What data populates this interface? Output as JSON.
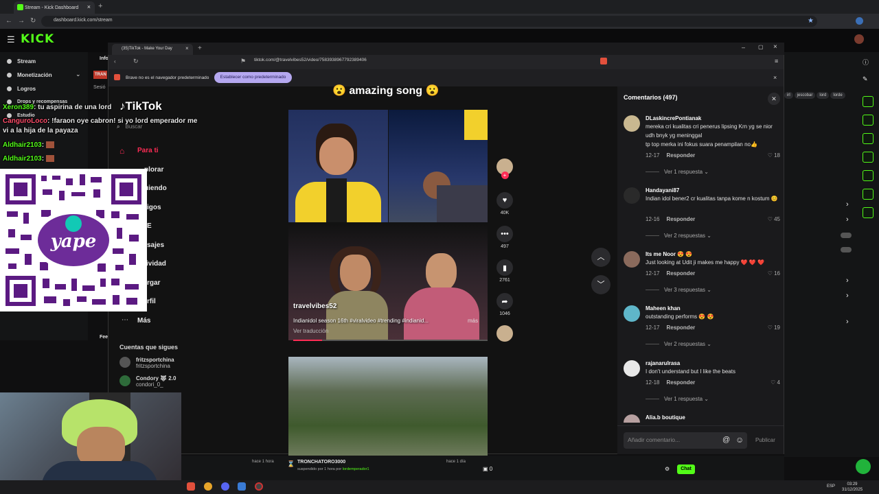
{
  "outer_browser": {
    "tab_title": "Stream - Kick Dashboard",
    "new_tab": "+",
    "url": "dashboard.kick.com/stream"
  },
  "kick": {
    "logo": "KICK",
    "sidebar": [
      {
        "label": "Stream",
        "icon": "broadcast-icon"
      },
      {
        "label": "Monetización",
        "icon": "money-icon"
      },
      {
        "label": "Logros",
        "icon": "trophy-icon"
      },
      {
        "label": "Drops y recompensas",
        "icon": "gift-icon"
      },
      {
        "label": "Estudio",
        "icon": "studio-icon"
      }
    ],
    "tags": [
      "irl",
      "jescobar",
      "lord",
      "lorde"
    ],
    "bottom_notice": {
      "name": "TRONCHATORO3000",
      "detail": "suspendido por 1 hora por ",
      "by": "lordemperador1",
      "time_left": "hace 1 hora",
      "time_right": "hace 1 día"
    },
    "viewer_count": "0",
    "chat_button": "Chat",
    "left_labels": {
      "info": "Info",
      "sesion": "Sesió",
      "fee": "Fee",
      "tran": "TRAN"
    }
  },
  "chat_overlay": [
    {
      "user": "Xeron389",
      "text": " tu aspirina de una lord"
    },
    {
      "user": "CanguroLoco",
      "text": " !faraon oye cabron! si yo lord emperador me"
    },
    {
      "user": "",
      "text": "vi a la hija de la payaza"
    },
    {
      "user": "Aldhair2103",
      "text": ""
    },
    {
      "user": "Aldhair2103",
      "text": ""
    }
  ],
  "tiktok_window": {
    "tab_title": "(35)TikTok - Make Your Day",
    "url": "tiktok.com/@travelvibes52/video/7583938967792389406",
    "infobar_message": "Brave no es el navegador predeterminado",
    "infobar_button": "Establecer como predeterminado"
  },
  "tiktok": {
    "logo": "TikTok",
    "search_placeholder": "Buscar",
    "nav": [
      {
        "label": "Para ti",
        "icon": "home-icon"
      },
      {
        "label": "plorar",
        "icon": "compass-icon"
      },
      {
        "label": "uiendo",
        "icon": "following-icon"
      },
      {
        "label": "igos",
        "icon": "friends-icon"
      },
      {
        "label": "E",
        "icon": "live-icon"
      },
      {
        "label": "sajes",
        "icon": "messages-icon"
      },
      {
        "label": "ividad",
        "icon": "activity-icon"
      },
      {
        "label": "rgar",
        "icon": "upload-icon"
      },
      {
        "label": "rfil",
        "icon": "profile-icon"
      },
      {
        "label": "Más",
        "icon": "more-icon"
      }
    ],
    "following_header": "Cuentas que sigues",
    "following": [
      {
        "name": "fritzsportchina",
        "handle": "fritzsportchina"
      },
      {
        "name": "Condory 🐺 2.0",
        "handle": "condori_0_"
      }
    ],
    "video": {
      "title": "amazing song",
      "author": "travelvibes52",
      "description": "Indianidol season 16th   #viralvideo #trending #indianid...",
      "more": "más",
      "translate": "Ver traducción",
      "progress": 0.15
    },
    "actions": {
      "likes": "40K",
      "comments": "497",
      "saves": "2761",
      "shares": "1046"
    },
    "comments_header": "Comentarios (497)",
    "comments": [
      {
        "user": "DLaskincrePontianak",
        "text": "mereka cri kualitas cri penerus lipsing Krn yg se nior udh bnyk yg meninggal\ntp top merka ini fokus suara penampilan no👍",
        "date": "12-17",
        "reply": "Responder",
        "likes": "18",
        "replies": "Ver 1 respuesta"
      },
      {
        "user": "Handayani87",
        "text": "Indian idol bener2 cr kualitas tanpa kome n kostum 😊",
        "date": "12-16",
        "reply": "Responder",
        "likes": "45",
        "replies": "Ver 2 respuestas"
      },
      {
        "user": "Its me Noor 😍 😍",
        "text": "Just looking at Udit ji makes me happy ❤️ ❤️ ❤️",
        "date": "12-17",
        "reply": "Responder",
        "likes": "16",
        "replies": "Ver 3 respuestas"
      },
      {
        "user": "Maheen khan",
        "text": "outstanding performs 😍 😍",
        "date": "12-17",
        "reply": "Responder",
        "likes": "19",
        "replies": "Ver 2 respuestas"
      },
      {
        "user": "rajanarulrasa",
        "text": "I don't understand but I like the beats",
        "date": "12-18",
        "reply": "Responder",
        "likes": "4",
        "replies": "Ver 1 respuesta"
      },
      {
        "user": "Alia.b boutique",
        "text": "",
        "date": "",
        "reply": "",
        "likes": "",
        "replies": ""
      }
    ],
    "comment_placeholder": "Añadir comentario...",
    "post_button": "Publicar"
  },
  "taskbar": {
    "lang": "ESP",
    "time": "03:29",
    "date": "31/12/2025"
  },
  "colors": {
    "kick_green": "#53fc18",
    "tiktok_red": "#fe2c55",
    "brave_purple": "#b5a8f0"
  }
}
